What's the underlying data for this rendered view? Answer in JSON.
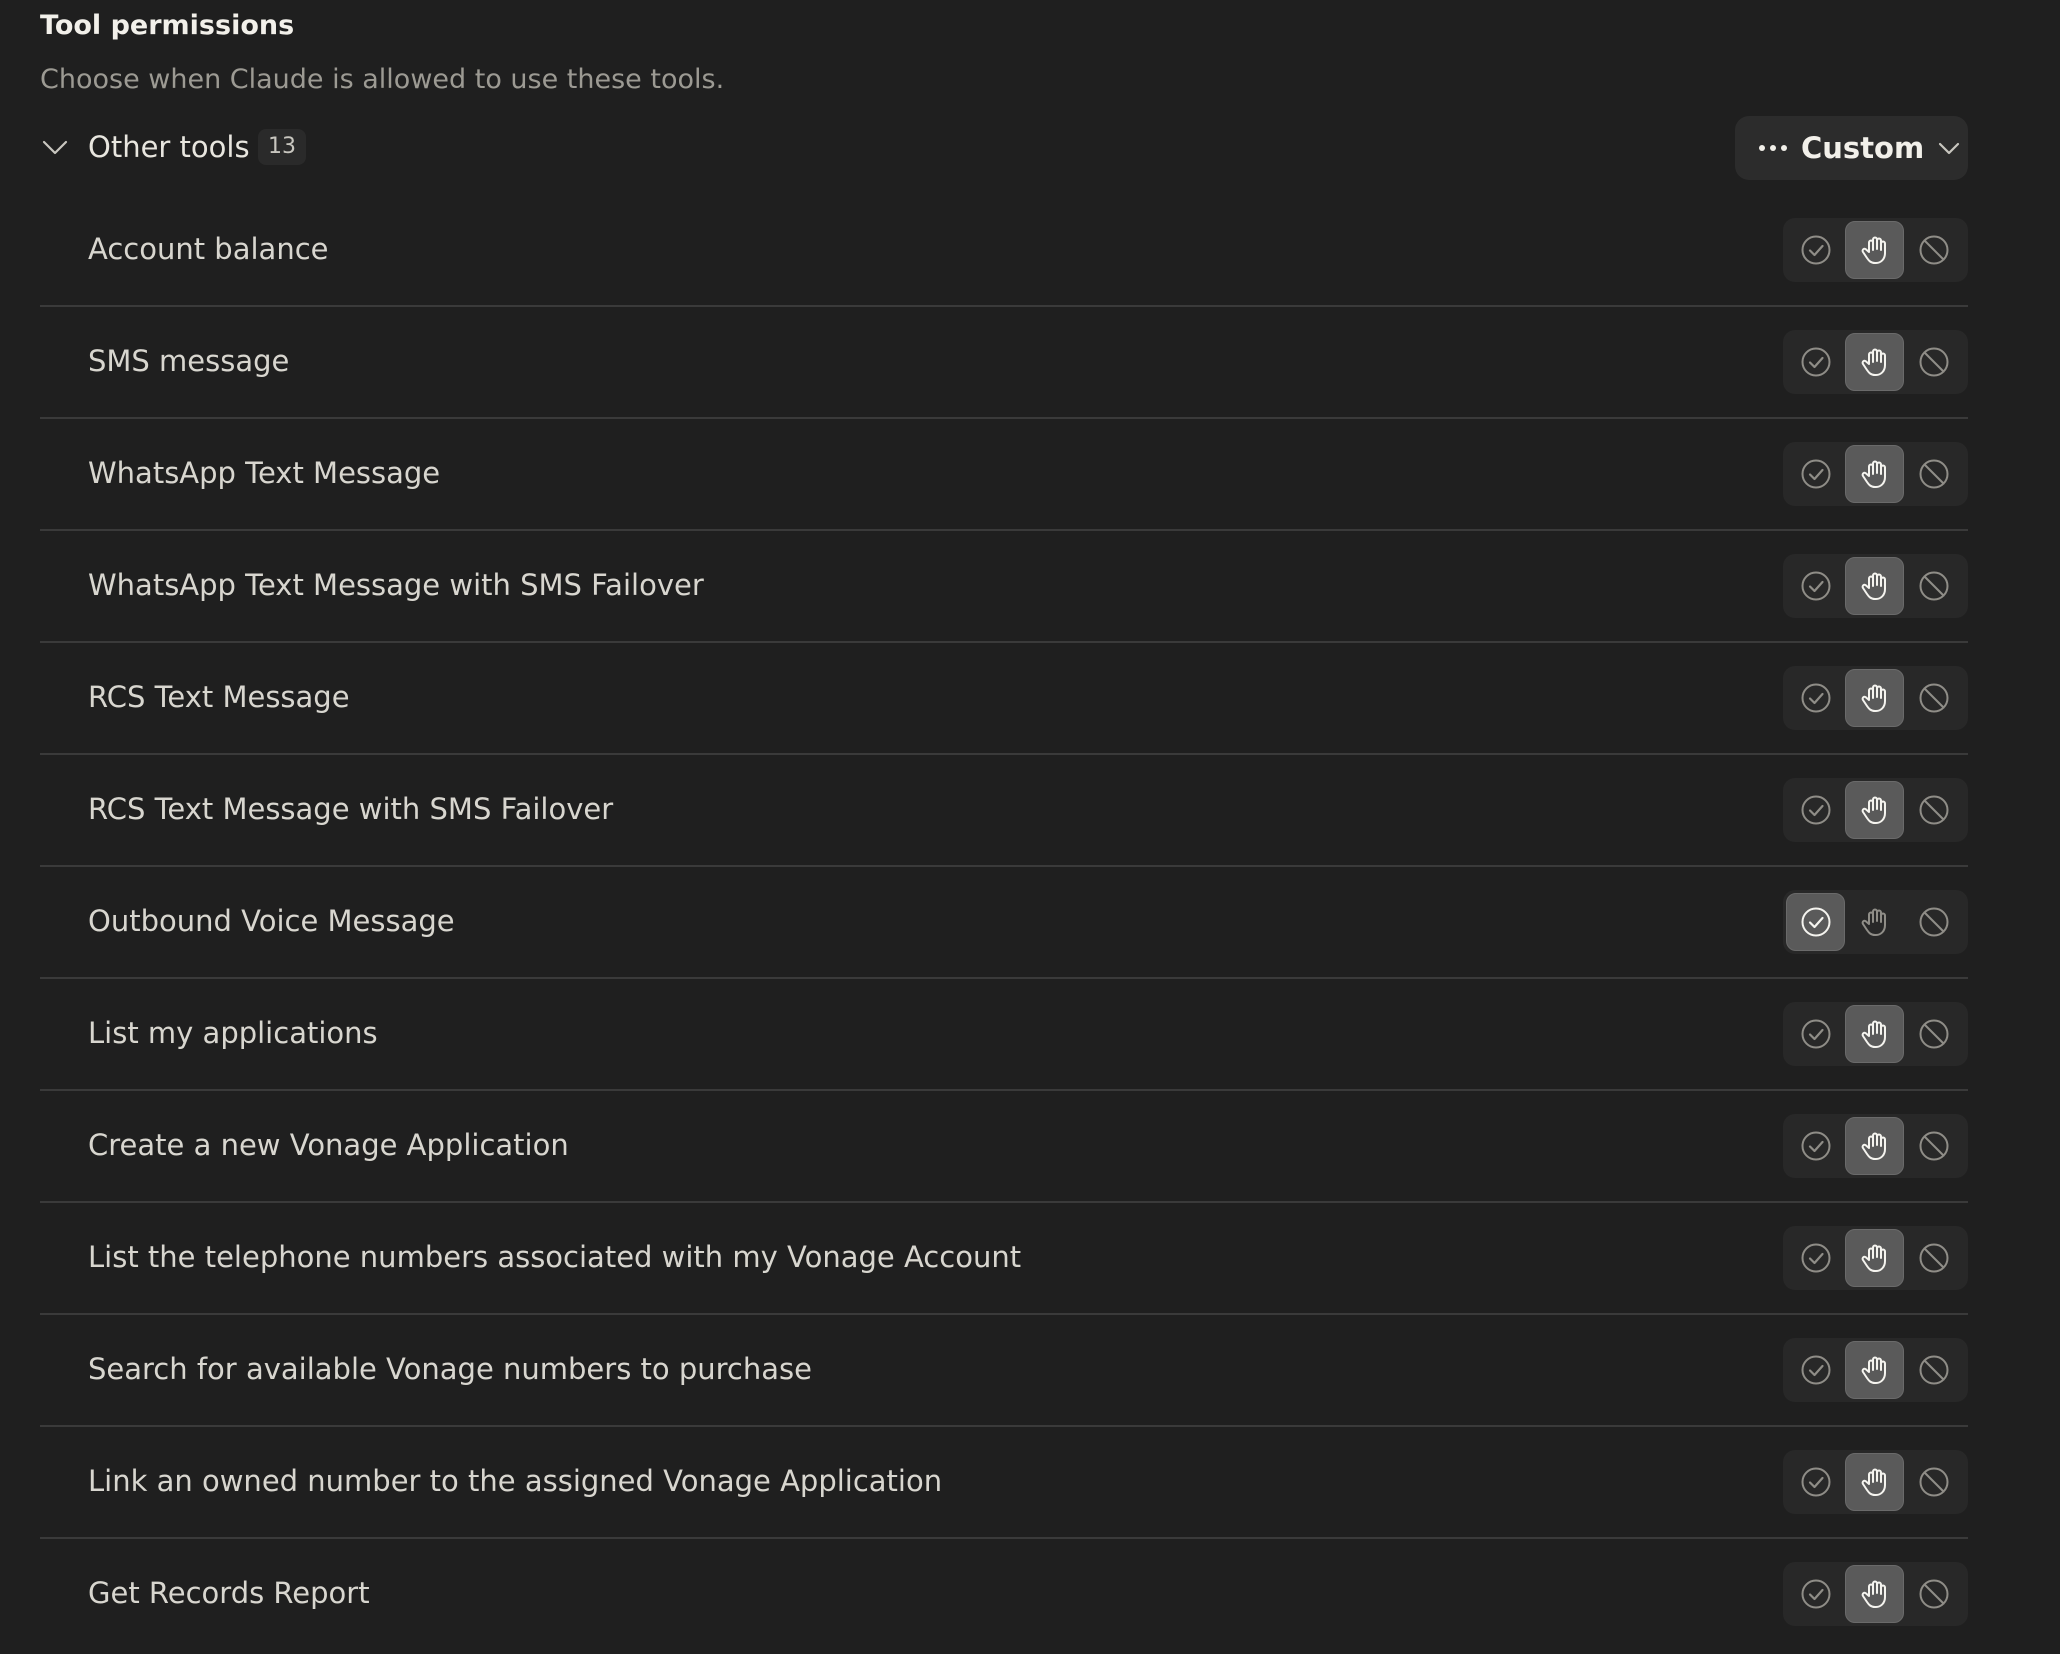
{
  "header": {
    "title": "Tool permissions",
    "subtitle": "Choose when Claude is allowed to use these tools."
  },
  "group": {
    "label": "Other tools",
    "count": "13",
    "expanded": true,
    "mode_button_label": "Custom"
  },
  "colors": {
    "background": "#1f1f1f",
    "row_divider": "#3a3a3a",
    "active_segment": "#5a5a5a",
    "segment_track": "#282828"
  },
  "permission_options": [
    "always-allow",
    "needs-approval",
    "blocked"
  ],
  "tools": [
    {
      "label": "Account balance",
      "permission": "needs-approval"
    },
    {
      "label": "SMS message",
      "permission": "needs-approval"
    },
    {
      "label": "WhatsApp Text Message",
      "permission": "needs-approval"
    },
    {
      "label": "WhatsApp Text Message with SMS Failover",
      "permission": "needs-approval"
    },
    {
      "label": "RCS Text Message",
      "permission": "needs-approval"
    },
    {
      "label": "RCS Text Message with SMS Failover",
      "permission": "needs-approval"
    },
    {
      "label": "Outbound Voice Message",
      "permission": "always-allow"
    },
    {
      "label": "List my applications",
      "permission": "needs-approval"
    },
    {
      "label": "Create a new Vonage Application",
      "permission": "needs-approval"
    },
    {
      "label": "List the telephone numbers associated with my Vonage Account",
      "permission": "needs-approval"
    },
    {
      "label": "Search for available Vonage numbers to purchase",
      "permission": "needs-approval"
    },
    {
      "label": "Link an owned number to the assigned Vonage Application",
      "permission": "needs-approval"
    },
    {
      "label": "Get Records Report",
      "permission": "needs-approval"
    }
  ]
}
